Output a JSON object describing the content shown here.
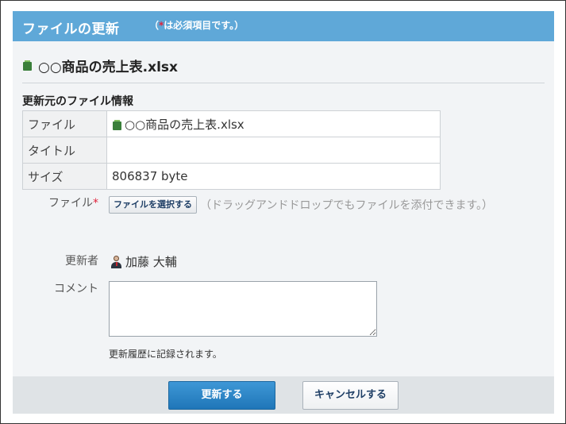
{
  "header": {
    "title": "ファイルの更新",
    "note_open": "（",
    "note_star": "*",
    "note_rest": "は必須項目です。）"
  },
  "file_name": "○○商品の売上表.xlsx",
  "source_section": {
    "title": "更新元のファイル情報",
    "rows": [
      {
        "label": "ファイル",
        "value": "○○商品の売上表.xlsx"
      },
      {
        "label": "タイトル",
        "value": ""
      },
      {
        "label": "サイズ",
        "value": "806837 byte"
      }
    ]
  },
  "form": {
    "file_label": "ファイル",
    "required_mark": "*",
    "select_button": "ファイルを選択する",
    "drag_hint": "（ドラッグアンドドロップでもファイルを添付できます。）",
    "updater_label": "更新者",
    "updater_name": "加藤 大輔",
    "comment_label": "コメント",
    "comment_value": "",
    "history_note": "更新履歴に記録されます。"
  },
  "buttons": {
    "update": "更新する",
    "cancel": "キャンセルする"
  },
  "colors": {
    "header_bg": "#5fa8d8",
    "required": "#e0243c",
    "primary_button": "#1f76b8"
  },
  "icons": [
    "excel-file-icon",
    "user-avatar-icon"
  ]
}
